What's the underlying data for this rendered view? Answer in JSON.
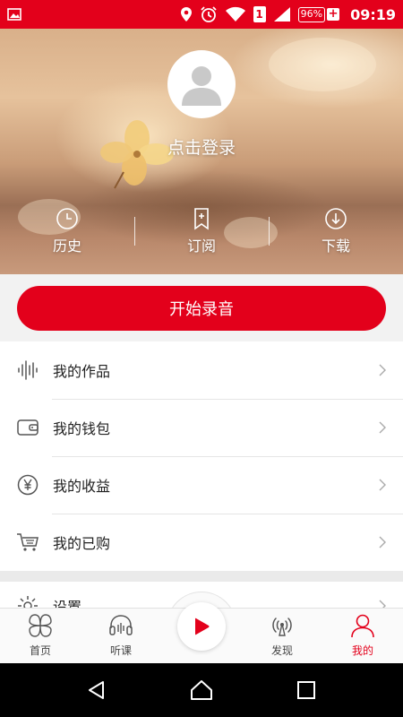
{
  "status_bar": {
    "battery": "96%",
    "battery_plus": "+",
    "sim": "1",
    "time": "09:19"
  },
  "profile": {
    "login_text": "点击登录"
  },
  "hero_actions": [
    {
      "label": "历史",
      "icon": "clock-icon"
    },
    {
      "label": "订阅",
      "icon": "bookmark-plus-icon"
    },
    {
      "label": "下载",
      "icon": "download-icon"
    }
  ],
  "record_button": "开始录音",
  "menu": [
    {
      "label": "我的作品",
      "icon": "waveform-icon"
    },
    {
      "label": "我的钱包",
      "icon": "wallet-icon"
    },
    {
      "label": "我的收益",
      "icon": "yuan-icon"
    },
    {
      "label": "我的已购",
      "icon": "cart-icon"
    }
  ],
  "menu_partial": {
    "label": "设置",
    "icon": "gear-icon"
  },
  "tabs": [
    {
      "label": "首页",
      "icon": "home-clover-icon"
    },
    {
      "label": "听课",
      "icon": "headphones-icon"
    },
    {
      "label": "发现",
      "icon": "radar-icon"
    },
    {
      "label": "我的",
      "icon": "person-icon"
    }
  ],
  "colors": {
    "accent": "#e3001b"
  }
}
